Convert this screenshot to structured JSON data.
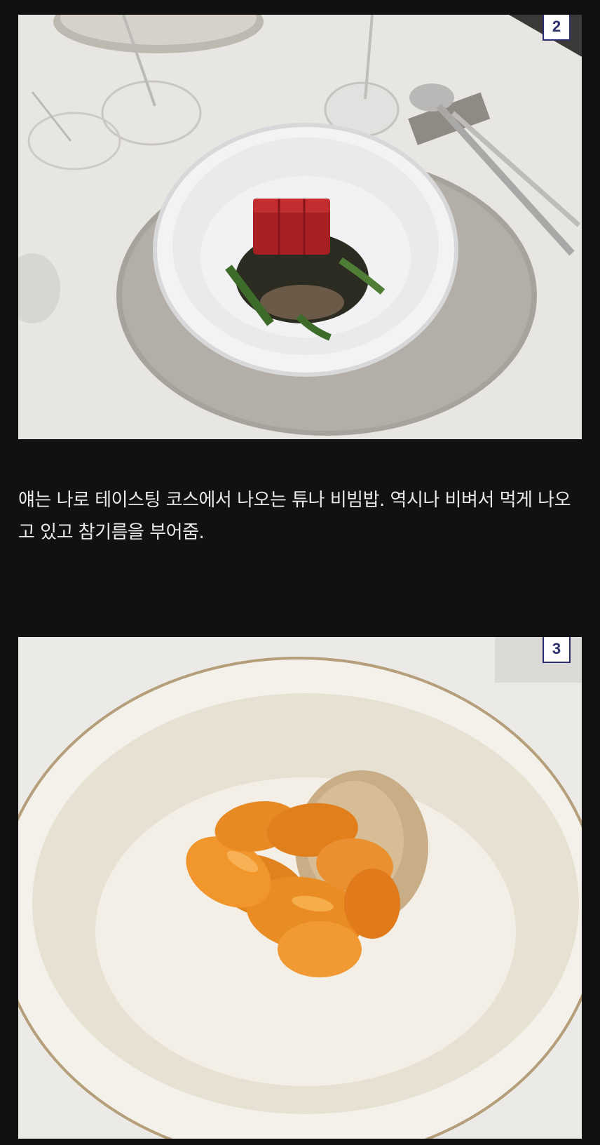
{
  "images": [
    {
      "badge": "2"
    },
    {
      "badge": "3"
    }
  ],
  "caption": "얘는 나로 테이스팅 코스에서 나오는 튜나 비빔밥. 역시나 비벼서 먹게 나오고 있고 참기름을 부어줌.",
  "colors": {
    "background": "#111112",
    "caption_text": "#e9e9ea",
    "badge_border": "#2b2f6b"
  }
}
